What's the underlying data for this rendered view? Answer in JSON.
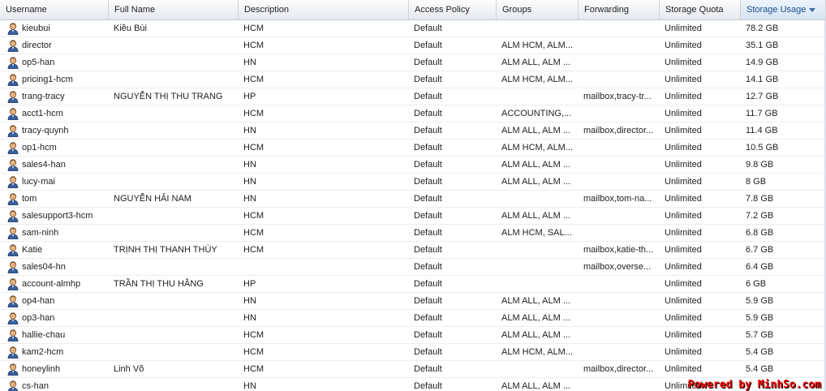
{
  "columns": [
    {
      "key": "username",
      "label": "Username"
    },
    {
      "key": "fullname",
      "label": "Full Name"
    },
    {
      "key": "description",
      "label": "Description"
    },
    {
      "key": "access",
      "label": "Access Policy"
    },
    {
      "key": "groups",
      "label": "Groups"
    },
    {
      "key": "forwarding",
      "label": "Forwarding"
    },
    {
      "key": "quota",
      "label": "Storage Quota"
    },
    {
      "key": "usage",
      "label": "Storage Usage"
    }
  ],
  "sorted_column": "usage",
  "sort_direction": "descending",
  "rows": [
    {
      "username": "kieubui",
      "fullname": "Kiều Bùi",
      "description": "HCM",
      "access": "Default",
      "groups": "",
      "forwarding": "",
      "quota": "Unlimited",
      "usage": "78.2 GB"
    },
    {
      "username": "director",
      "fullname": "",
      "description": "HCM",
      "access": "Default",
      "groups": "ALM HCM, ALM...",
      "forwarding": "",
      "quota": "Unlimited",
      "usage": "35.1 GB"
    },
    {
      "username": "op5-han",
      "fullname": "",
      "description": "HN",
      "access": "Default",
      "groups": "ALM ALL, ALM ...",
      "forwarding": "",
      "quota": "Unlimited",
      "usage": "14.9 GB"
    },
    {
      "username": "pricing1-hcm",
      "fullname": "",
      "description": "HCM",
      "access": "Default",
      "groups": "ALM HCM, ALM...",
      "forwarding": "",
      "quota": "Unlimited",
      "usage": "14.1 GB"
    },
    {
      "username": "trang-tracy",
      "fullname": "NGUYỄN THỊ THU TRANG",
      "description": "HP",
      "access": "Default",
      "groups": "",
      "forwarding": "mailbox,tracy-tr...",
      "quota": "Unlimited",
      "usage": "12.7 GB"
    },
    {
      "username": "acct1-hcm",
      "fullname": "",
      "description": "HCM",
      "access": "Default",
      "groups": "ACCOUNTING,...",
      "forwarding": "",
      "quota": "Unlimited",
      "usage": "11.7 GB"
    },
    {
      "username": "tracy-quynh",
      "fullname": "",
      "description": "HN",
      "access": "Default",
      "groups": "ALM ALL, ALM ...",
      "forwarding": "mailbox,director...",
      "quota": "Unlimited",
      "usage": "11.4 GB"
    },
    {
      "username": "op1-hcm",
      "fullname": "",
      "description": "HCM",
      "access": "Default",
      "groups": "ALM HCM, ALM...",
      "forwarding": "",
      "quota": "Unlimited",
      "usage": "10.5 GB"
    },
    {
      "username": "sales4-han",
      "fullname": "",
      "description": "HN",
      "access": "Default",
      "groups": "ALM ALL, ALM ...",
      "forwarding": "",
      "quota": "Unlimited",
      "usage": "9.8 GB"
    },
    {
      "username": "lucy-mai",
      "fullname": "",
      "description": "HN",
      "access": "Default",
      "groups": "ALM ALL, ALM ...",
      "forwarding": "",
      "quota": "Unlimited",
      "usage": "8 GB"
    },
    {
      "username": "tom",
      "fullname": "NGUYỄN HẢI NAM",
      "description": "HN",
      "access": "Default",
      "groups": "",
      "forwarding": "mailbox,tom-na...",
      "quota": "Unlimited",
      "usage": "7.8 GB"
    },
    {
      "username": "salesupport3-hcm",
      "fullname": "",
      "description": "HCM",
      "access": "Default",
      "groups": "ALM ALL, ALM ...",
      "forwarding": "",
      "quota": "Unlimited",
      "usage": "7.2 GB"
    },
    {
      "username": "sam-ninh",
      "fullname": "",
      "description": "HCM",
      "access": "Default",
      "groups": "ALM HCM, SAL...",
      "forwarding": "",
      "quota": "Unlimited",
      "usage": "6.8 GB"
    },
    {
      "username": "Katie",
      "fullname": "TRỊNH THỊ THANH THÙY",
      "description": "HCM",
      "access": "Default",
      "groups": "",
      "forwarding": "mailbox,katie-th...",
      "quota": "Unlimited",
      "usage": "6.7 GB"
    },
    {
      "username": "sales04-hn",
      "fullname": "",
      "description": "",
      "access": "Default",
      "groups": "",
      "forwarding": "mailbox,overse...",
      "quota": "Unlimited",
      "usage": "6.4 GB"
    },
    {
      "username": "account-almhp",
      "fullname": "TRẦN THỊ THU HẰNG",
      "description": "HP",
      "access": "Default",
      "groups": "",
      "forwarding": "",
      "quota": "Unlimited",
      "usage": "6 GB"
    },
    {
      "username": "op4-han",
      "fullname": "",
      "description": "HN",
      "access": "Default",
      "groups": "ALM ALL, ALM ...",
      "forwarding": "",
      "quota": "Unlimited",
      "usage": "5.9 GB"
    },
    {
      "username": "op3-han",
      "fullname": "",
      "description": "HN",
      "access": "Default",
      "groups": "ALM ALL, ALM ...",
      "forwarding": "",
      "quota": "Unlimited",
      "usage": "5.9 GB"
    },
    {
      "username": "hallie-chau",
      "fullname": "",
      "description": "HCM",
      "access": "Default",
      "groups": "ALM ALL, ALM ...",
      "forwarding": "",
      "quota": "Unlimited",
      "usage": "5.7 GB"
    },
    {
      "username": "kam2-hcm",
      "fullname": "",
      "description": "HCM",
      "access": "Default",
      "groups": "ALM HCM, ALM...",
      "forwarding": "",
      "quota": "Unlimited",
      "usage": "5.4 GB"
    },
    {
      "username": "honeylinh",
      "fullname": "Linh Võ",
      "description": "HCM",
      "access": "Default",
      "groups": "",
      "forwarding": "mailbox,director...",
      "quota": "Unlimited",
      "usage": "5.4 GB"
    },
    {
      "username": "cs-han",
      "fullname": "",
      "description": "HN",
      "access": "Default",
      "groups": "ALM ALL, ALM ...",
      "forwarding": "",
      "quota": "Unlimited",
      "usage": ""
    }
  ],
  "icons": {
    "user_row": "user-icon",
    "sort": "sort-desc-icon"
  },
  "colors": {
    "header_sorted_text": "#1c4f8a",
    "watermark": "#ff0000"
  },
  "watermark": "Powered by MinhSo.com"
}
